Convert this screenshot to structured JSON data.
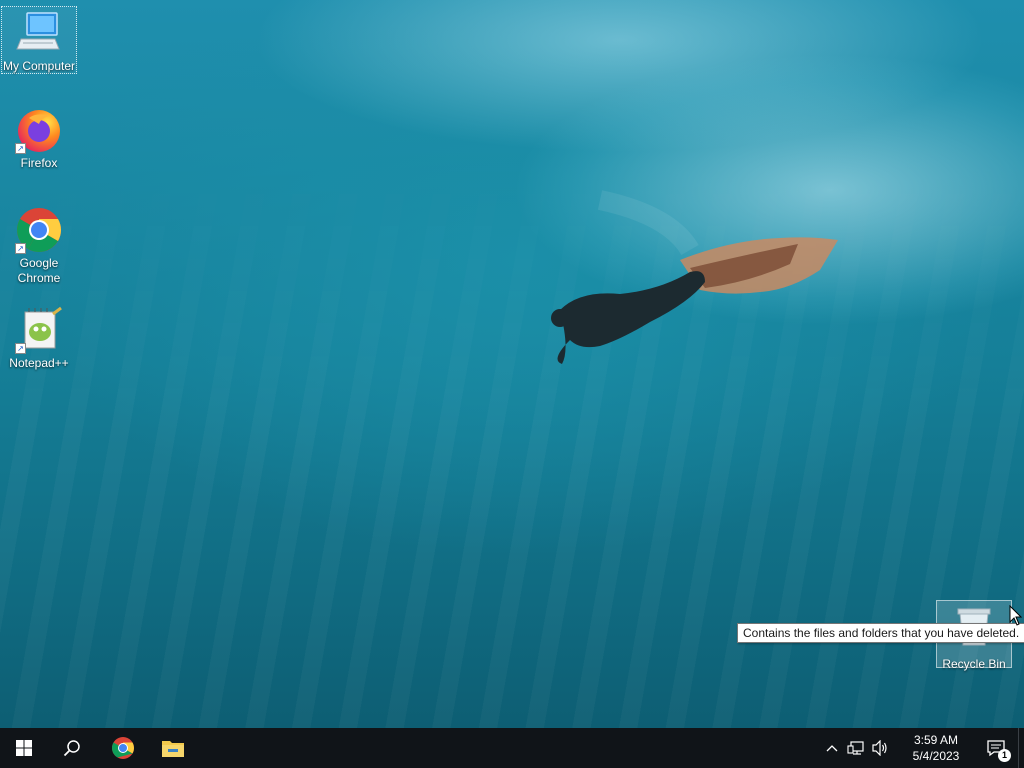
{
  "desktop": {
    "icons": [
      {
        "label": "My Computer",
        "icon": "computer-icon"
      },
      {
        "label": "Firefox",
        "icon": "firefox-icon"
      },
      {
        "label": "Google Chrome",
        "icon": "chrome-icon"
      },
      {
        "label": "Notepad++",
        "icon": "notepad-plus-plus-icon"
      },
      {
        "label": "Recycle Bin",
        "icon": "recycle-bin-icon"
      }
    ],
    "tooltip": "Contains the files and folders that you have deleted."
  },
  "taskbar": {
    "start": "windows-start-icon",
    "search": "search-icon",
    "pinned": [
      "chrome-icon",
      "file-explorer-icon"
    ],
    "tray": {
      "icons": [
        "chevron-up-icon",
        "network-icon",
        "volume-icon"
      ],
      "time": "3:59 AM",
      "date": "5/4/2023",
      "notification_count": "1"
    }
  },
  "colors": {
    "taskbar": "#101418",
    "wallpaper_top": "#1f8fae",
    "wallpaper_bottom": "#0d5e73"
  }
}
